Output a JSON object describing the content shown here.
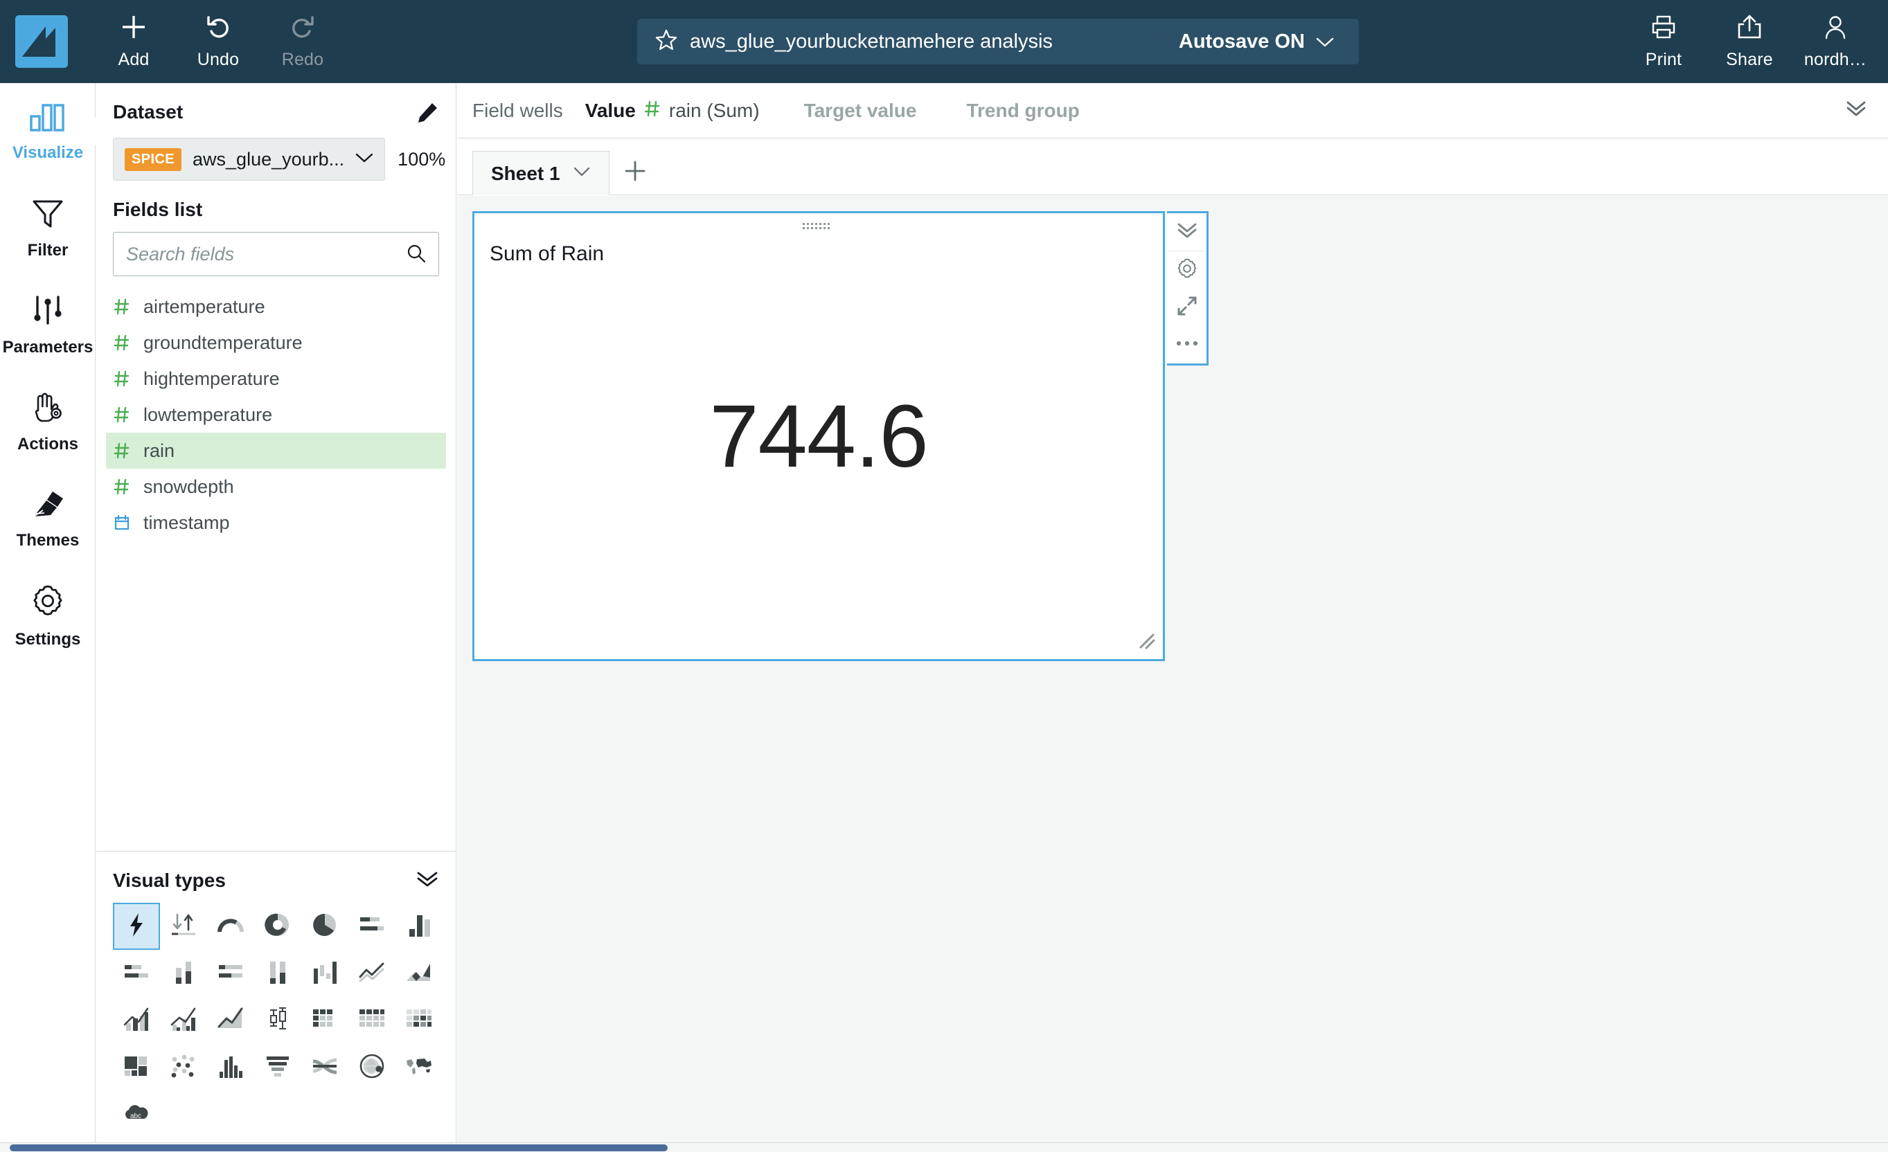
{
  "topbar": {
    "logo_name": "quicksight-logo",
    "buttons": [
      {
        "label": "Add",
        "icon": "plus-icon",
        "enabled": true
      },
      {
        "label": "Undo",
        "icon": "undo-icon",
        "enabled": true
      },
      {
        "label": "Redo",
        "icon": "redo-icon",
        "enabled": false
      }
    ],
    "title": "aws_glue_yourbucketnamehere analysis",
    "autosave": "Autosave ON",
    "right_buttons": [
      {
        "label": "Print",
        "icon": "printer-icon"
      },
      {
        "label": "Share",
        "icon": "share-icon"
      },
      {
        "label": "nordh…",
        "icon": "user-icon"
      }
    ]
  },
  "rail": {
    "items": [
      {
        "label": "Visualize",
        "icon": "bar-chart-icon",
        "active": true
      },
      {
        "label": "Filter",
        "icon": "funnel-icon",
        "active": false
      },
      {
        "label": "Parameters",
        "icon": "sliders-icon",
        "active": false
      },
      {
        "label": "Actions",
        "icon": "hand-gear-icon",
        "active": false
      },
      {
        "label": "Themes",
        "icon": "paintbrush-icon",
        "active": false
      },
      {
        "label": "Settings",
        "icon": "gear-icon",
        "active": false
      }
    ]
  },
  "dataset": {
    "section_title": "Dataset",
    "badge": "SPICE",
    "name": "aws_glue_yourb...",
    "percent": "100%",
    "edit_icon": "pencil-icon",
    "chevron_icon": "chevron-down-icon"
  },
  "fields": {
    "section_title": "Fields list",
    "search_placeholder": "Search fields",
    "search_value": "",
    "search_icon": "search-icon",
    "items": [
      {
        "name": "airtemperature",
        "type": "number",
        "selected": false
      },
      {
        "name": "groundtemperature",
        "type": "number",
        "selected": false
      },
      {
        "name": "hightemperature",
        "type": "number",
        "selected": false
      },
      {
        "name": "lowtemperature",
        "type": "number",
        "selected": false
      },
      {
        "name": "rain",
        "type": "number",
        "selected": true
      },
      {
        "name": "snowdepth",
        "type": "number",
        "selected": false
      },
      {
        "name": "timestamp",
        "type": "date",
        "selected": false
      }
    ]
  },
  "visual_types": {
    "section_title": "Visual types",
    "collapse_icon": "double-chevron-down-icon",
    "items": [
      {
        "name": "autograph",
        "icon": "lightning-bolt-icon",
        "selected": true
      },
      {
        "name": "kpi",
        "icon": "kpi-arrows-icon",
        "selected": false
      },
      {
        "name": "gauge",
        "icon": "gauge-icon",
        "selected": false
      },
      {
        "name": "donut-chart",
        "icon": "donut-icon",
        "selected": false
      },
      {
        "name": "pie-chart",
        "icon": "pie-icon",
        "selected": false
      },
      {
        "name": "horizontal-bar-chart",
        "icon": "h-bar-icon",
        "selected": false
      },
      {
        "name": "vertical-bar-chart",
        "icon": "v-bar-icon",
        "selected": false
      },
      {
        "name": "horizontal-stacked-bar",
        "icon": "h-stacked-bar-icon",
        "selected": false
      },
      {
        "name": "vertical-stacked-bar",
        "icon": "v-stacked-bar-icon",
        "selected": false
      },
      {
        "name": "horizontal-100-stacked-bar",
        "icon": "h-100-bar-icon",
        "selected": false
      },
      {
        "name": "vertical-100-stacked-bar",
        "icon": "v-100-bar-icon",
        "selected": false
      },
      {
        "name": "waterfall-chart",
        "icon": "waterfall-icon",
        "selected": false
      },
      {
        "name": "line-chart",
        "icon": "line-icon",
        "selected": false
      },
      {
        "name": "stacked-area-chart",
        "icon": "stacked-area-icon",
        "selected": false
      },
      {
        "name": "line-and-bar-combo",
        "icon": "combo-bar-line-icon",
        "selected": false
      },
      {
        "name": "clustered-combo",
        "icon": "clustered-combo-icon",
        "selected": false
      },
      {
        "name": "area-line-chart",
        "icon": "area-line-icon",
        "selected": false
      },
      {
        "name": "box-plot",
        "icon": "box-plot-icon",
        "selected": false
      },
      {
        "name": "table",
        "icon": "table-icon",
        "selected": false
      },
      {
        "name": "pivot-table",
        "icon": "pivot-table-icon",
        "selected": false
      },
      {
        "name": "heat-map",
        "icon": "heatmap-icon",
        "selected": false
      },
      {
        "name": "tree-map",
        "icon": "treemap-icon",
        "selected": false
      },
      {
        "name": "scatter-plot",
        "icon": "scatter-icon",
        "selected": false
      },
      {
        "name": "histogram",
        "icon": "histogram-icon",
        "selected": false
      },
      {
        "name": "funnel-chart",
        "icon": "funnel-chart-icon",
        "selected": false
      },
      {
        "name": "sankey-diagram",
        "icon": "sankey-icon",
        "selected": false
      },
      {
        "name": "radar-globe-chart",
        "icon": "globe-icon",
        "selected": false
      },
      {
        "name": "geospatial-map",
        "icon": "world-map-icon",
        "selected": false
      },
      {
        "name": "word-cloud",
        "icon": "word-cloud-icon",
        "selected": false
      }
    ]
  },
  "field_wells": {
    "label": "Field wells",
    "value_key": "Value",
    "value_field": "rain (Sum)",
    "target_value": "Target value",
    "trend_group": "Trend group",
    "collapse_icon": "double-chevron-down-icon"
  },
  "sheets": {
    "tabs": [
      {
        "label": "Sheet 1",
        "active": true
      }
    ],
    "add_icon": "plus-icon",
    "tab_chevron_icon": "chevron-down-icon"
  },
  "visual": {
    "title": "Sum of Rain",
    "kpi_value": "744.6",
    "grip_icon": "drag-grip-icon",
    "resize_icon": "resize-handle-icon",
    "controls": [
      {
        "name": "collapse",
        "icon": "double-chevron-down-icon"
      },
      {
        "name": "format",
        "icon": "gear-icon"
      },
      {
        "name": "maximize",
        "icon": "expand-arrows-icon"
      },
      {
        "name": "menu",
        "icon": "ellipsis-icon"
      }
    ]
  },
  "colors": {
    "topbar_bg": "#1e3d4f",
    "accent_blue": "#4ca9e0",
    "spice_orange": "#f0982d",
    "field_green": "#4caf50",
    "selected_field_bg": "#d7efd7",
    "canvas_bg": "#f4f5f5",
    "scrollbar_thumb": "#4a6c9b"
  },
  "chart_data": {
    "type": "table",
    "title": "Sum of Rain",
    "categories": [
      "Sum of Rain"
    ],
    "values": [
      744.6
    ],
    "xlabel": "",
    "ylabel": ""
  }
}
